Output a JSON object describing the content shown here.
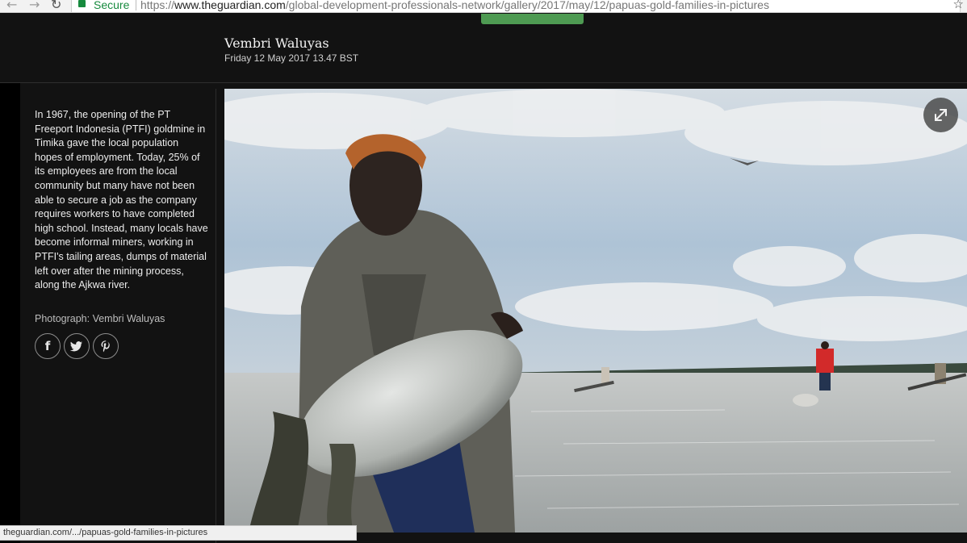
{
  "browser": {
    "secure_label": "Secure",
    "url_scheme": "https://",
    "url_domain": "www.theguardian.com",
    "url_path": "/global-development-professionals-network/gallery/2017/may/12/papuas-gold-families-in-pictures",
    "status_url": "theguardian.com/.../papuas-gold-families-in-pictures"
  },
  "header": {
    "author": "Vembri Waluyas",
    "date": "Friday 12 May 2017 13.47 BST"
  },
  "caption": {
    "text": "In 1967, the opening of the PT Freeport Indonesia (PTFI) goldmine in Timika gave the local population hopes of employment. Today, 25% of its employees are from the local community but many have not been able to secure a job as the company requires workers to have completed high school. Instead, many locals have become informal miners, working in PTFI's tailing areas, dumps of material left over after the mining process, along the Ajkwa river.",
    "credit": "Photograph: Vembri Waluyas"
  },
  "share": {
    "facebook_icon": "f",
    "twitter_icon": "🐦",
    "pinterest_icon": "℘"
  },
  "icons": {
    "back": "←",
    "forward": "→",
    "reload": "↻",
    "star": "☆"
  },
  "colors": {
    "page_background": "#121212",
    "secure_green": "#178a3e",
    "header_accent": "#4e9a52"
  }
}
